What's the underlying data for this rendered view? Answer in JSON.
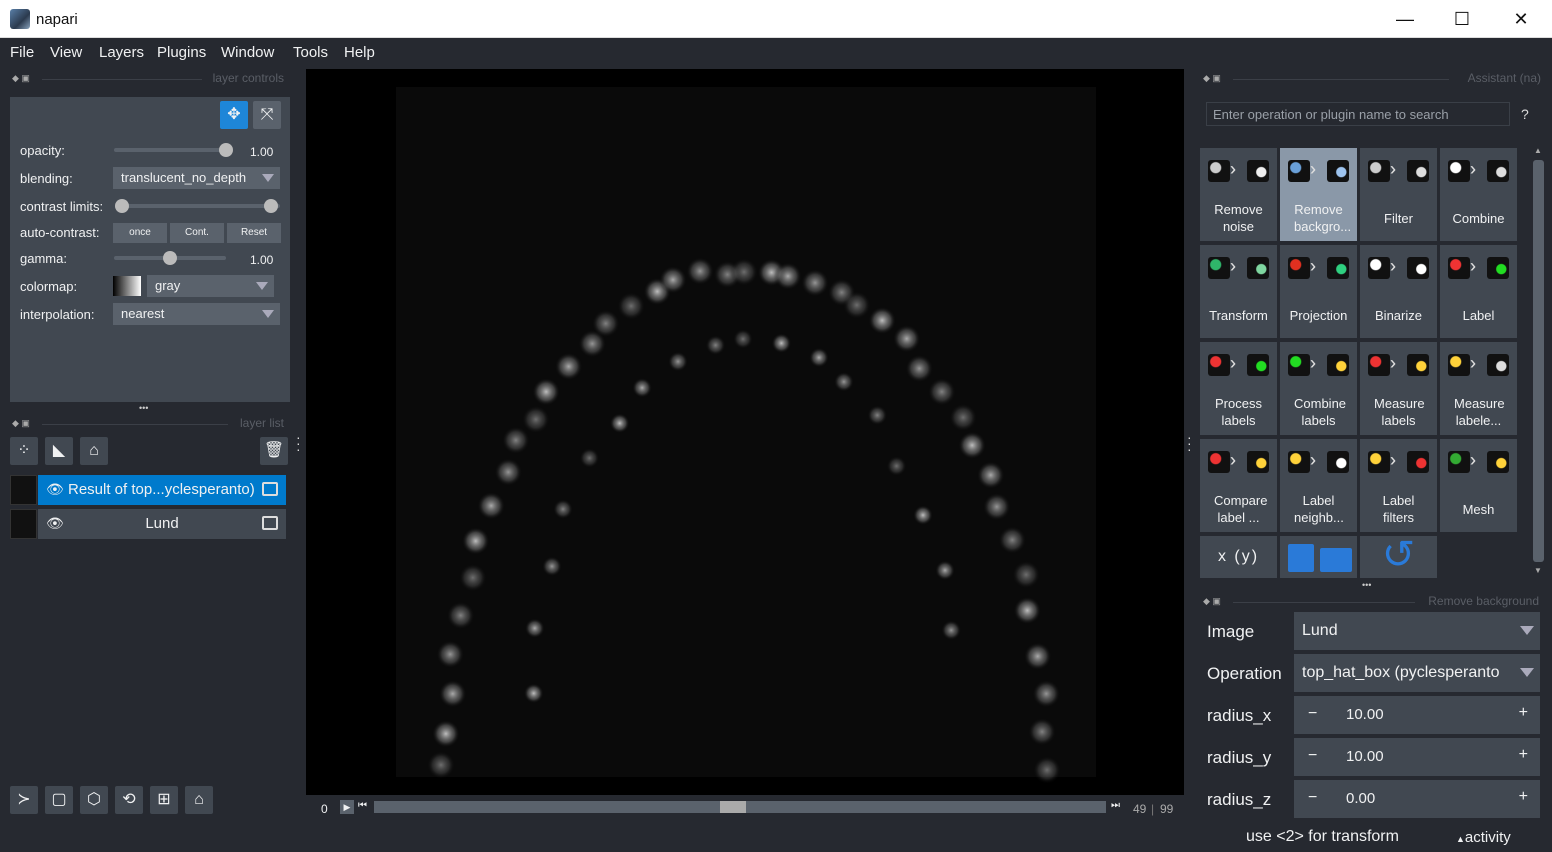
{
  "window": {
    "title": "napari",
    "minimize": "—",
    "maximize": "☐",
    "close": "✕"
  },
  "menu": [
    "File",
    "View",
    "Layers",
    "Plugins",
    "Window",
    "Tools",
    "Help"
  ],
  "layer_controls": {
    "title": "layer controls",
    "opacity_label": "opacity:",
    "opacity_value": "1.00",
    "opacity_level": 1.0,
    "blending_label": "blending:",
    "blending_value": "translucent_no_depth",
    "contrast_label": "contrast limits:",
    "autocontrast_label": "auto-contrast:",
    "once": "once",
    "cont": "Cont.",
    "reset": "Reset",
    "gamma_label": "gamma:",
    "gamma_value": "1.00",
    "gamma_level": 0.5,
    "colormap_label": "colormap:",
    "colormap_value": "gray",
    "interpolation_label": "interpolation:",
    "interpolation_value": "nearest",
    "handle": "•••"
  },
  "layer_list": {
    "title": "layer list",
    "layers": [
      {
        "name": "Result of top...yclesperanto)",
        "selected": true
      },
      {
        "name": "Lund",
        "selected": false
      }
    ]
  },
  "dims": {
    "start": "0",
    "current": "49",
    "separator": "|",
    "max": "99",
    "position_fraction": 0.49
  },
  "assistant": {
    "title": "Assistant (na)",
    "search_placeholder": "Enter operation or plugin name to search",
    "help": "?",
    "tiles": [
      {
        "label": "Remove noise",
        "selected": false
      },
      {
        "label": "Remove backgro...",
        "selected": true
      },
      {
        "label": "Filter",
        "selected": false
      },
      {
        "label": "Combine",
        "selected": false
      },
      {
        "label": "Transform",
        "selected": false
      },
      {
        "label": "Projection",
        "selected": false
      },
      {
        "label": "Binarize",
        "selected": false
      },
      {
        "label": "Label",
        "selected": false
      },
      {
        "label": "Process labels",
        "selected": false
      },
      {
        "label": "Combine labels",
        "selected": false
      },
      {
        "label": "Measure labels",
        "selected": false
      },
      {
        "label": "Measure labele...",
        "selected": false
      },
      {
        "label": "Compare label ...",
        "selected": false
      },
      {
        "label": "Label neighb...",
        "selected": false
      },
      {
        "label": "Label filters",
        "selected": false
      },
      {
        "label": "Mesh",
        "selected": false
      }
    ],
    "code_tile": "x (y)",
    "handle": "•••"
  },
  "remove_background": {
    "title": "Remove background",
    "image_label": "Image",
    "image_value": "Lund",
    "operation_label": "Operation",
    "operation_value": "top_hat_box (pyclesperanto",
    "rx_label": "radius_x",
    "rx_value": "10.00",
    "ry_label": "radius_y",
    "ry_value": "10.00",
    "rz_label": "radius_z",
    "rz_value": "0.00",
    "minus": "−",
    "plus": "+"
  },
  "status": {
    "hint": "use <2> for transform",
    "activity": "activity"
  }
}
